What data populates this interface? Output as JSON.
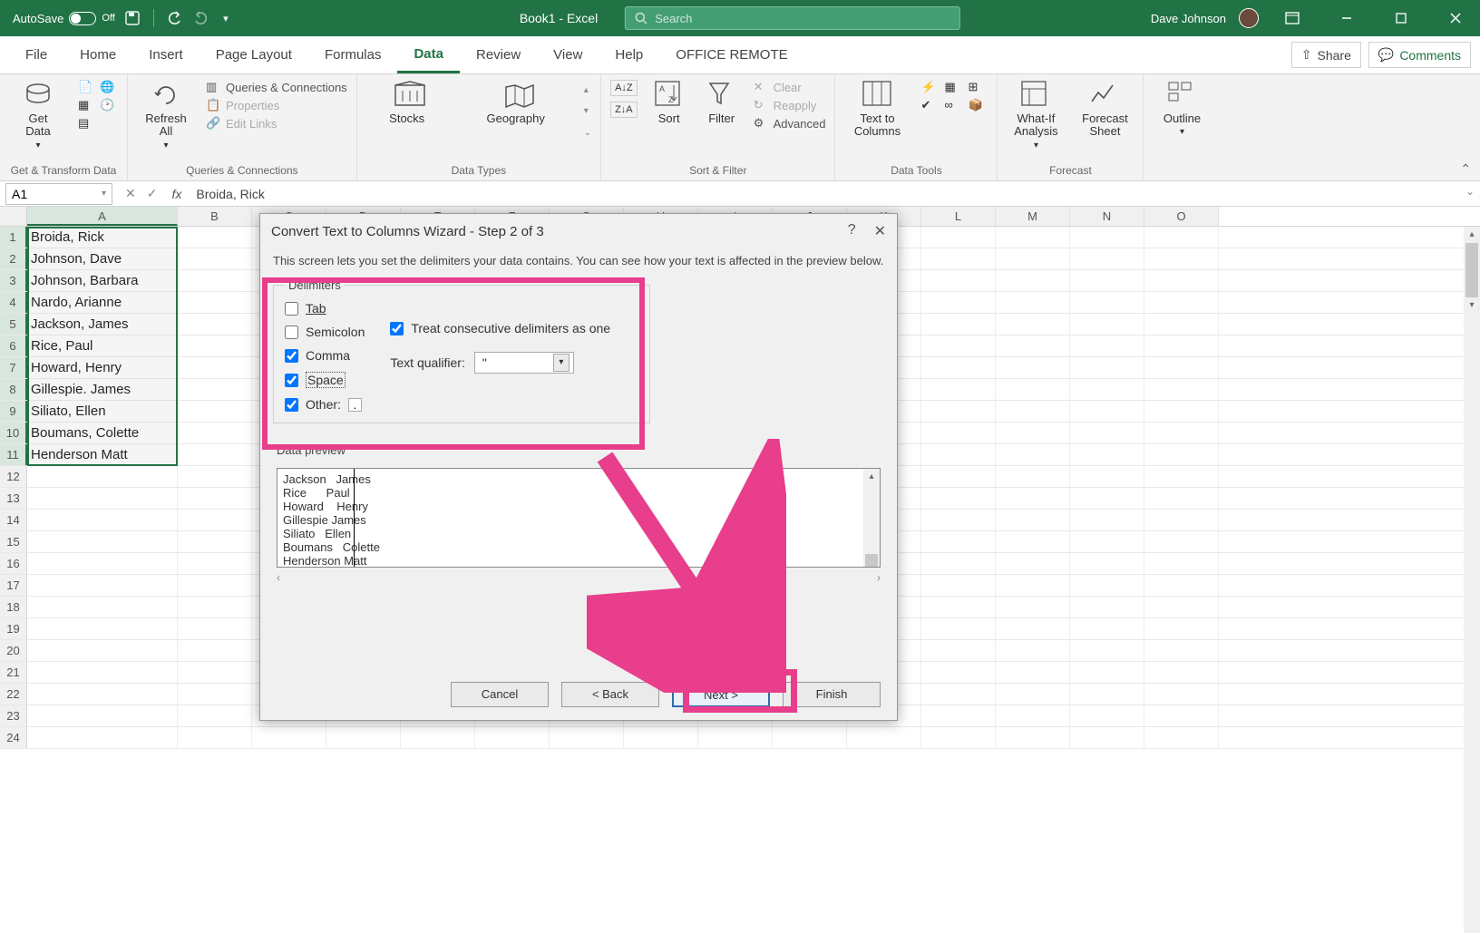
{
  "titlebar": {
    "autosave_label": "AutoSave",
    "autosave_state": "Off",
    "doc_title": "Book1 - Excel",
    "search_placeholder": "Search",
    "user_name": "Dave Johnson"
  },
  "tabs": {
    "file": "File",
    "home": "Home",
    "insert": "Insert",
    "page_layout": "Page Layout",
    "formulas": "Formulas",
    "data": "Data",
    "review": "Review",
    "view": "View",
    "help": "Help",
    "office_remote": "OFFICE REMOTE",
    "share": "Share",
    "comments": "Comments",
    "active": "Data"
  },
  "ribbon": {
    "get_data": "Get\nData",
    "refresh_all": "Refresh\nAll",
    "queries_conn": "Queries & Connections",
    "properties": "Properties",
    "edit_links": "Edit Links",
    "stocks": "Stocks",
    "geography": "Geography",
    "sort": "Sort",
    "filter": "Filter",
    "clear": "Clear",
    "reapply": "Reapply",
    "advanced": "Advanced",
    "text_to_columns": "Text to\nColumns",
    "whatif": "What-If\nAnalysis",
    "forecast": "Forecast\nSheet",
    "outline": "Outline",
    "groups": {
      "g1": "Get & Transform Data",
      "g2": "Queries & Connections",
      "g3": "Data Types",
      "g4": "Sort & Filter",
      "g5": "Data Tools",
      "g6": "Forecast"
    }
  },
  "formula_bar": {
    "name_box": "A1",
    "formula": "Broida, Rick"
  },
  "columns": [
    "A",
    "B",
    "C",
    "D",
    "E",
    "F",
    "G",
    "H",
    "I",
    "J",
    "K",
    "L",
    "M",
    "N",
    "O"
  ],
  "rows_count": 24,
  "cell_data": [
    "Broida, Rick",
    "Johnson, Dave",
    "Johnson, Barbara",
    "Nardo, Arianne",
    "Jackson, James",
    "Rice, Paul",
    "Howard, Henry",
    "Gillespie. James",
    "Siliato, Ellen",
    "Boumans, Colette",
    "Henderson Matt"
  ],
  "dialog": {
    "title": "Convert Text to Columns Wizard - Step 2 of 3",
    "desc": "This screen lets you set the delimiters your data contains.  You can see how your text is affected in the preview below.",
    "delimiters_legend": "Delimiters",
    "tab": "Tab",
    "semicolon": "Semicolon",
    "comma": "Comma",
    "space": "Space",
    "other": "Other:",
    "other_value": ".",
    "treat_consecutive": "Treat consecutive delimiters as one",
    "text_qualifier_label": "Text qualifier:",
    "text_qualifier_value": "\"",
    "preview_label": "Data preview",
    "preview_rows": [
      [
        "Jackson",
        "James"
      ],
      [
        "Rice",
        "Paul"
      ],
      [
        "Howard",
        "Henry"
      ],
      [
        "Gillespie",
        "James"
      ],
      [
        "Siliato",
        "Ellen"
      ],
      [
        "Boumans",
        "Colette"
      ],
      [
        "Henderson",
        "Matt"
      ]
    ],
    "btn_cancel": "Cancel",
    "btn_back": "< Back",
    "btn_next": "Next >",
    "btn_finish": "Finish"
  }
}
